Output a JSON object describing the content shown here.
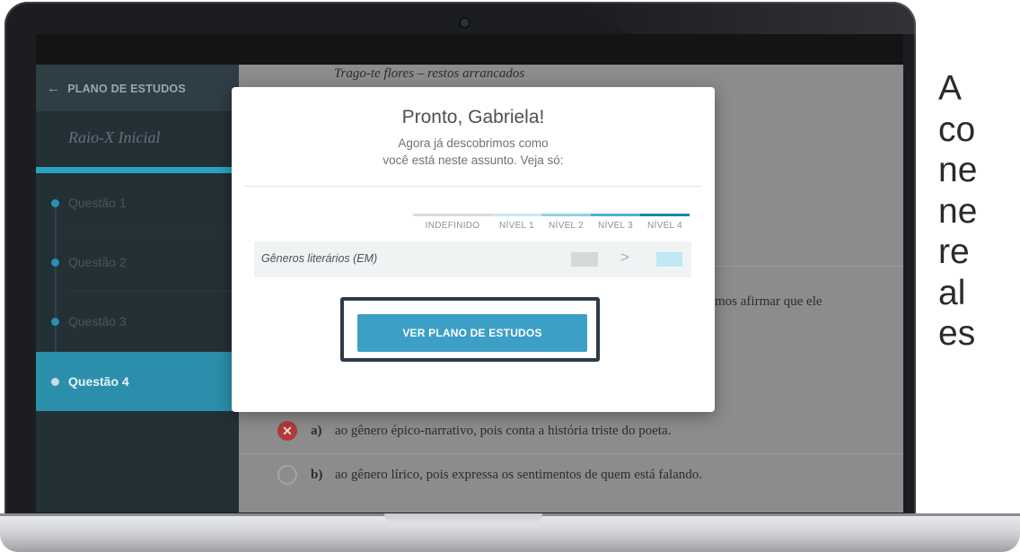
{
  "sidebar": {
    "back_label": "PLANO DE ESTUDOS",
    "course_title": "Raio-X Inicial",
    "questions": [
      "Questão 1",
      "Questão 2",
      "Questão 3",
      "Questão 4"
    ],
    "active_question_index": 3
  },
  "content": {
    "poem_line": "Trago-te flores – restos arrancados",
    "stem_visible_fragment": "mos afirmar que ele",
    "options": [
      {
        "letter": "a)",
        "text": "ao gênero épico-narrativo, pois conta a história triste do poeta.",
        "state": "wrong"
      },
      {
        "letter": "b)",
        "text": "ao gênero lírico, pois expressa os sentimentos de quem está falando.",
        "state": "unselected"
      }
    ]
  },
  "modal": {
    "title": "Pronto, Gabriela!",
    "subtitle_lines": [
      "Agora já descobrimos como",
      "você está neste assunto. Veja só:"
    ],
    "levels": [
      {
        "label": "INDEFINIDO",
        "color": "#d9dbdd"
      },
      {
        "label": "NÍVEL 1",
        "color": "#c7e9f3"
      },
      {
        "label": "NÍVEL 2",
        "color": "#8fd0e6"
      },
      {
        "label": "NÍVEL 3",
        "color": "#4fb0d0"
      },
      {
        "label": "NÍVEL 4",
        "color": "#1b86ab"
      }
    ],
    "topic": "Gêneros literários (EM)",
    "from_level": "INDEFINIDO",
    "to_level": "NÍVEL 1",
    "button_label": "VER PLANO DE ESTUDOS"
  },
  "side_text_lines": [
    "A",
    "co",
    "ne",
    "ne",
    "re",
    "al",
    "es"
  ],
  "colors": {
    "accent": "#2b8fab",
    "button": "#3b9fc6",
    "sidebar_bg": "#233036",
    "wrong": "#b03939"
  }
}
